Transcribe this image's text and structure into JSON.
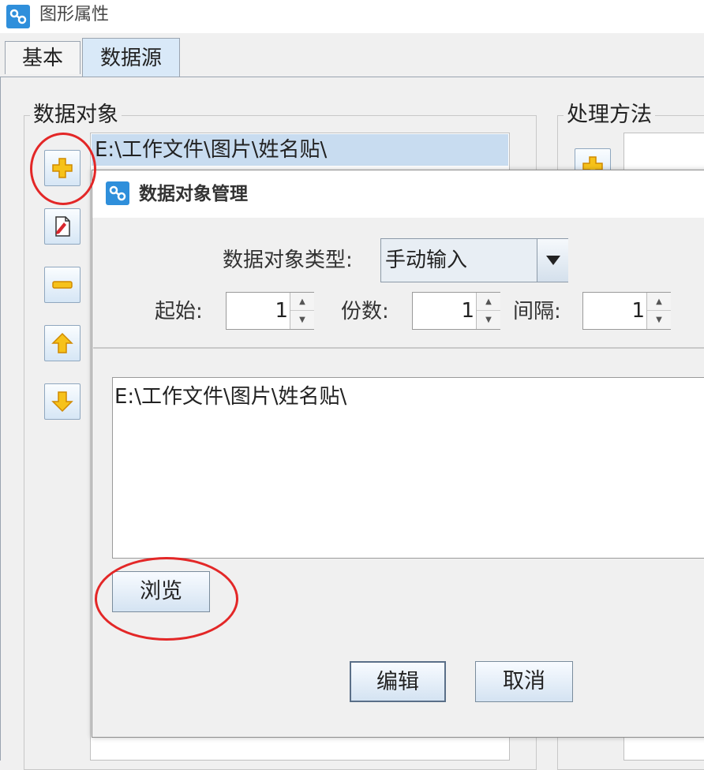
{
  "window": {
    "title": "图形属性"
  },
  "tabs": [
    {
      "label": "基本",
      "active": false
    },
    {
      "label": "数据源",
      "active": true
    }
  ],
  "data_object_group": {
    "legend": "数据对象",
    "rows": [
      "E:\\工作文件\\图片\\姓名贴\\"
    ],
    "buttons": [
      {
        "name": "add",
        "icon": "plus-icon"
      },
      {
        "name": "edit",
        "icon": "edit-document-icon"
      },
      {
        "name": "remove",
        "icon": "minus-icon"
      },
      {
        "name": "move-up",
        "icon": "arrow-up-icon"
      },
      {
        "name": "move-down",
        "icon": "arrow-down-icon"
      }
    ]
  },
  "processing_group": {
    "legend": "处理方法"
  },
  "dialog": {
    "title": "数据对象管理",
    "type_label": "数据对象类型:",
    "type_value": "手动输入",
    "start_label": "起始:",
    "start_value": "1",
    "copies_label": "份数:",
    "copies_value": "1",
    "interval_label": "间隔:",
    "interval_value": "1",
    "text_content": "E:\\工作文件\\图片\\姓名贴\\",
    "browse_label": "浏览",
    "edit_label": "编辑",
    "cancel_label": "取消"
  },
  "colors": {
    "selected_row": "#c8dcf0",
    "annotation": "#e32727",
    "active_tab": "#d9e9f8"
  }
}
